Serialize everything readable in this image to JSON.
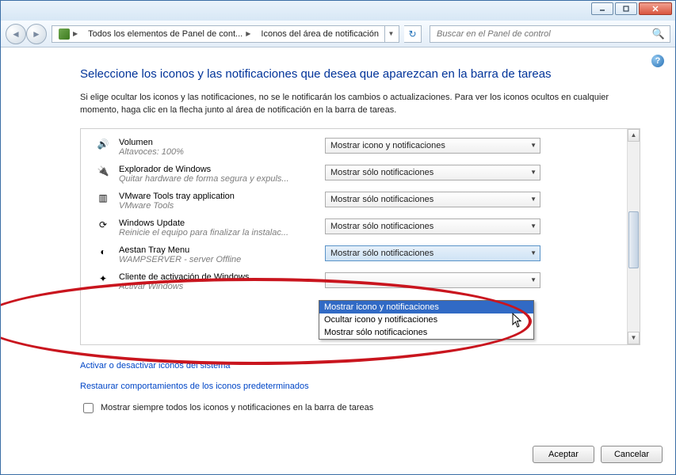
{
  "breadcrumb": {
    "root_icon": "control-panel",
    "seg1": "Todos los elementos de Panel de cont...",
    "seg2": "Iconos del área de notificación"
  },
  "search": {
    "placeholder": "Buscar en el Panel de control"
  },
  "page": {
    "title": "Seleccione los iconos y las notificaciones que desea que aparezcan en la barra de tareas",
    "intro": "Si elige ocultar los iconos y las notificaciones, no se le notificarán los cambios o actualizaciones. Para ver los iconos ocultos en cualquier momento, haga clic en la flecha junto al área de notificación en la barra de tareas."
  },
  "items": [
    {
      "icon": "volume-icon",
      "title": "Volumen",
      "sub": "Altavoces: 100%",
      "value": "Mostrar icono y notificaciones"
    },
    {
      "icon": "usb-icon",
      "title": "Explorador de Windows",
      "sub": "Quitar hardware de forma segura y expuls...",
      "value": "Mostrar sólo notificaciones"
    },
    {
      "icon": "vmware-icon",
      "title": "VMware Tools tray application",
      "sub": "VMware Tools",
      "value": "Mostrar sólo notificaciones"
    },
    {
      "icon": "update-icon",
      "title": "Windows Update",
      "sub": "Reinicie el equipo para finalizar la instalac...",
      "value": "Mostrar sólo notificaciones"
    },
    {
      "icon": "wamp-icon",
      "title": "Aestan Tray Menu",
      "sub": "WAMPSERVER - server Offline",
      "value": "Mostrar sólo notificaciones"
    },
    {
      "icon": "activation-icon",
      "title": "Cliente de activación de Windows",
      "sub": "Activar Windows",
      "value": ""
    }
  ],
  "dropdown_options": [
    "Mostrar icono y notificaciones",
    "Ocultar icono y notificaciones",
    "Mostrar sólo notificaciones"
  ],
  "links": {
    "system_icons": "Activar o desactivar iconos del sistema",
    "restore_defaults": "Restaurar comportamientos de los iconos predeterminados"
  },
  "checkbox_label": "Mostrar siempre todos los iconos y notificaciones en la barra de tareas",
  "buttons": {
    "ok": "Aceptar",
    "cancel": "Cancelar"
  }
}
